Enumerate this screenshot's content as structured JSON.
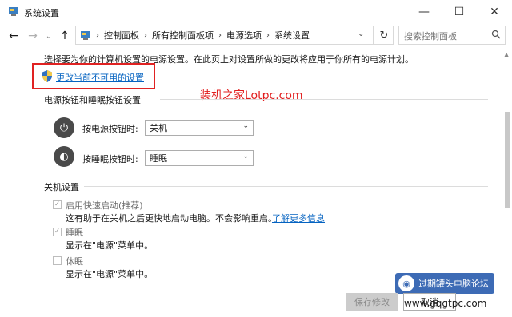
{
  "window": {
    "title": "系统设置",
    "minimize_glyph": "—",
    "maximize_glyph": "☐",
    "close_glyph": "✕"
  },
  "nav": {
    "back_glyph": "←",
    "forward_glyph": "→",
    "recent_glyph": "⌄",
    "up_glyph": "↑",
    "refresh_glyph": "↻",
    "breadcrumb": [
      "控制面板",
      "所有控制面板项",
      "电源选项",
      "系统设置"
    ],
    "breadcrumb_sep": "›",
    "dropdown_glyph": "⌄",
    "search_placeholder": "搜索控制面板",
    "search_icon": "search-icon"
  },
  "intro": {
    "text": "选择要为你的计算机设置的电源设置。在此页上对设置所做的更改将应用于你所有的电源计划。",
    "change_link": "更改当前不可用的设置"
  },
  "watermark_text": "装机之家Lotpc.com",
  "power_buttons": {
    "section_title": "电源按钮和睡眠按钮设置",
    "power_label": "按电源按钮时:",
    "power_value": "关机",
    "sleep_label": "按睡眠按钮时:",
    "sleep_value": "睡眠"
  },
  "shutdown": {
    "section_title": "关机设置",
    "fast_startup_label": "启用快速启动(推荐)",
    "fast_startup_desc": "这有助于在关机之后更快地启动电脑。不会影响重启。",
    "learn_more": "了解更多信息",
    "sleep_label": "睡眠",
    "sleep_desc": "显示在\"电源\"菜单中。",
    "hibernate_label": "休眠",
    "hibernate_desc": "显示在\"电源\"菜单中。",
    "fast_startup_checked": true,
    "sleep_checked": true,
    "hibernate_checked": false
  },
  "buttons": {
    "save": "保存修改",
    "cancel": "取消"
  },
  "overlay": {
    "forum_text": "过期罐头电脑论坛",
    "site_text": "www.gqgtpc.com"
  },
  "colors": {
    "link": "#0563c1",
    "highlight_box": "#e02222",
    "watermark": "#e11d1d"
  }
}
